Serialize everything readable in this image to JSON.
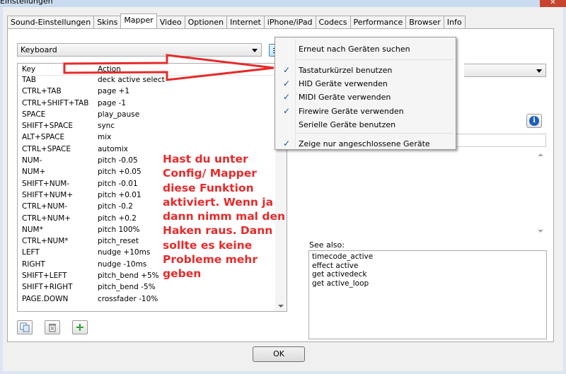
{
  "window": {
    "title": "Einstellungen",
    "close_glyph": "✕"
  },
  "tabs": [
    {
      "label": "Sound-Einstellungen"
    },
    {
      "label": "Skins"
    },
    {
      "label": "Mapper",
      "active": true
    },
    {
      "label": "Video"
    },
    {
      "label": "Optionen"
    },
    {
      "label": "Internet"
    },
    {
      "label": "iPhone/iPad"
    },
    {
      "label": "Codecs"
    },
    {
      "label": "Performance"
    },
    {
      "label": "Browser"
    },
    {
      "label": "Info"
    }
  ],
  "mapper": {
    "device_select": "Keyboard",
    "columns": {
      "key": "Key",
      "action": "Action"
    },
    "rows": [
      {
        "key": "TAB",
        "action": "deck active select"
      },
      {
        "key": "CTRL+TAB",
        "action": "page +1"
      },
      {
        "key": "CTRL+SHIFT+TAB",
        "action": "page -1"
      },
      {
        "key": "SPACE",
        "action": "play_pause"
      },
      {
        "key": "SHIFT+SPACE",
        "action": "sync"
      },
      {
        "key": "ALT+SPACE",
        "action": "mix"
      },
      {
        "key": "CTRL+SPACE",
        "action": "automix"
      },
      {
        "key": "NUM-",
        "action": "pitch -0.05"
      },
      {
        "key": "NUM+",
        "action": "pitch +0.05"
      },
      {
        "key": "SHIFT+NUM-",
        "action": "pitch -0.01"
      },
      {
        "key": "SHIFT+NUM+",
        "action": "pitch +0.01"
      },
      {
        "key": "CTRL+NUM-",
        "action": "pitch -0.2"
      },
      {
        "key": "CTRL+NUM+",
        "action": "pitch +0.2"
      },
      {
        "key": "NUM*",
        "action": "pitch 100%"
      },
      {
        "key": "CTRL+NUM*",
        "action": "pitch_reset"
      },
      {
        "key": "LEFT",
        "action": "nudge +10ms"
      },
      {
        "key": "RIGHT",
        "action": "nudge -10ms"
      },
      {
        "key": "SHIFT+LEFT",
        "action": "pitch_bend +5%"
      },
      {
        "key": "SHIFT+RIGHT",
        "action": "pitch_bend -5%"
      },
      {
        "key": "PAGE.DOWN",
        "action": "crossfader -10%"
      }
    ],
    "toolbar_icons": [
      "copy-icon",
      "trash-icon",
      "add-icon"
    ],
    "add_glyph": "+",
    "info_glyph": "i",
    "see_also_label": "See also:",
    "see_also": [
      "timecode_active",
      "effect active",
      "get activedeck",
      "get active_loop"
    ]
  },
  "context_menu": {
    "items": [
      {
        "label": "Erneut nach Geräten suchen",
        "checked": false
      },
      {
        "label": "Tastaturkürzel benutzen",
        "checked": true
      },
      {
        "label": "HID Geräte verwenden",
        "checked": true
      },
      {
        "label": "MIDI Geräte verwenden",
        "checked": true
      },
      {
        "label": "Firewire Geräte verwenden",
        "checked": true
      },
      {
        "label": "Serielle Geräte benutzen",
        "checked": false
      },
      {
        "label": "Zeige nur angeschlossene Geräte",
        "checked": true
      }
    ],
    "check_glyph": "✓"
  },
  "annotation": {
    "lines": [
      "Hast du unter",
      "Config/ Mapper",
      "diese Funktion",
      "aktiviert. Wenn ja",
      "dann nimm mal den",
      "Haken raus. Dann",
      "sollte es keine",
      "Probleme mehr",
      "geben"
    ],
    "color": "#e52b2b"
  },
  "dialog": {
    "ok_label": "OK"
  }
}
